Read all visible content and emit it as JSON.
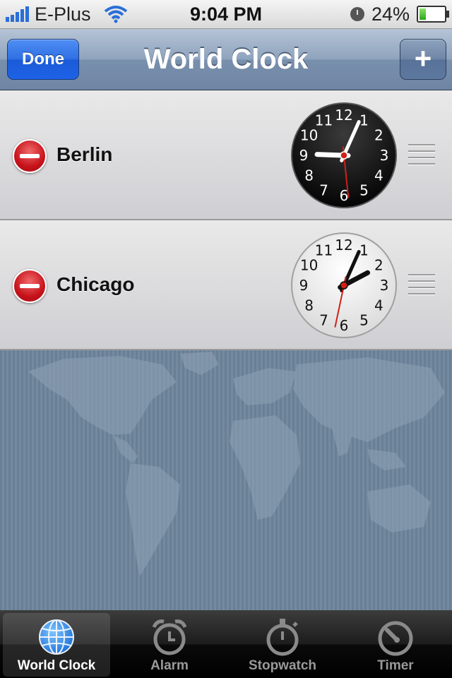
{
  "status_bar": {
    "carrier": "E-Plus",
    "time": "9:04 PM",
    "battery": "24%",
    "battery_level": 0.24,
    "icons": [
      "signal-icon",
      "wifi-icon",
      "alarm-clock-icon",
      "battery-icon"
    ]
  },
  "nav": {
    "title": "World Clock",
    "done_label": "Done",
    "add_label": "+"
  },
  "clocks": [
    {
      "city": "Berlin",
      "face": "dark",
      "hour": 9,
      "minute": 4,
      "second": 29
    },
    {
      "city": "Chicago",
      "face": "light",
      "hour": 2,
      "minute": 4,
      "second": 32
    }
  ],
  "clock_numerals": [
    "12",
    "1",
    "2",
    "3",
    "4",
    "5",
    "6",
    "7",
    "8",
    "9",
    "10",
    "11"
  ],
  "tabs": [
    {
      "label": "World Clock",
      "icon": "globe-icon",
      "selected": true
    },
    {
      "label": "Alarm",
      "icon": "alarm-clock-icon",
      "selected": false
    },
    {
      "label": "Stopwatch",
      "icon": "stopwatch-icon",
      "selected": false
    },
    {
      "label": "Timer",
      "icon": "timer-icon",
      "selected": false
    }
  ],
  "colors": {
    "done_button": "#1b5bd8",
    "delete_badge": "#c7121b",
    "second_hand": "#d0201a",
    "nav_bar": "#7990ad"
  }
}
